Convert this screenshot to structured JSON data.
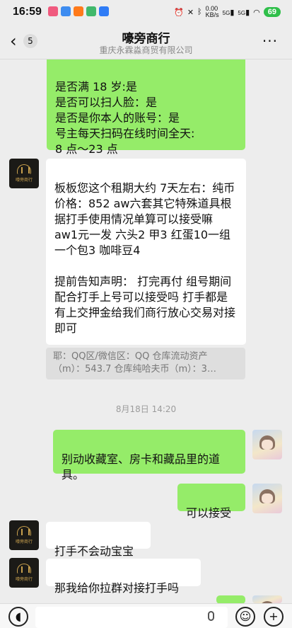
{
  "status": {
    "time": "16:59",
    "net_speed_top": "0.00",
    "net_speed_bottom": "KB/s",
    "sig1": "5G",
    "sig2": "5G",
    "battery": "69"
  },
  "header": {
    "back_count": "5",
    "title": "嚎旁商行",
    "subtitle": "重庆永霖淼商贸有限公司"
  },
  "messages": {
    "m1": "是否满 18 岁:是\n是否可以扫人脸：是\n是否是你本人的账号：是\n号主每天扫码在线时间全天:\n8 点～23 点",
    "m2": "板板您这个租期大约 7天左右：纯币价格：852   aw六套其它特殊道具根据打手使用情况单算可以接受嘛\naw1元一发 六头2  甲3  红蛋10一组 一个包3 咖啡豆4\n\n提前告知声明：  打完再付 组号期间配合打手上号可以接受吗  打手都是有上交押金给我们商行放心交易对接即可",
    "quote_line1": "耶：QQ区/微信区：QQ 仓库流动资产",
    "quote_line2": "（m）：543.7 仓库纯哈夫币（m）：3…",
    "time_sep": "8月18日 14:20",
    "m3": "别动收藏室、房卡和藏品里的道具。",
    "m4": "可以接受",
    "m5": "打手不会动宝宝",
    "m6": "那我给你拉群对接打手吗"
  },
  "avatars": {
    "shop_logo_text": "嚎旁商行"
  },
  "colors": {
    "green_bubble": "#95ec69",
    "white_bubble": "#ffffff",
    "background": "#ededed"
  }
}
